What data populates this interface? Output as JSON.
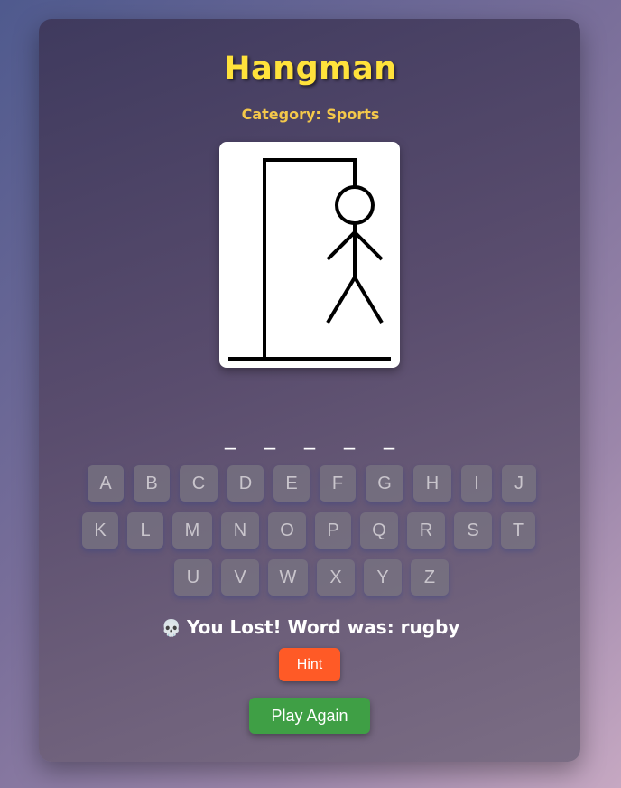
{
  "game": {
    "title": "Hangman",
    "category": "Category: Sports",
    "word_blanks": [
      "_",
      "_",
      "_",
      "_",
      "_"
    ],
    "keyboard_rows": [
      [
        "A",
        "B",
        "C",
        "D",
        "E",
        "F",
        "G",
        "H",
        "I",
        "J"
      ],
      [
        "K",
        "L",
        "M",
        "N",
        "O",
        "P",
        "Q",
        "R",
        "S",
        "T"
      ],
      [
        "U",
        "V",
        "W",
        "X",
        "Y",
        "Z"
      ]
    ],
    "status_icon": "💀",
    "status_text": "You Lost! Word was: rugby",
    "hint_label": "Hint",
    "play_again_label": "Play Again"
  },
  "colors": {
    "title": "#ffe23b",
    "category": "#f4c84a",
    "hint_button": "#ff5a26",
    "play_button": "#3f9f45"
  }
}
